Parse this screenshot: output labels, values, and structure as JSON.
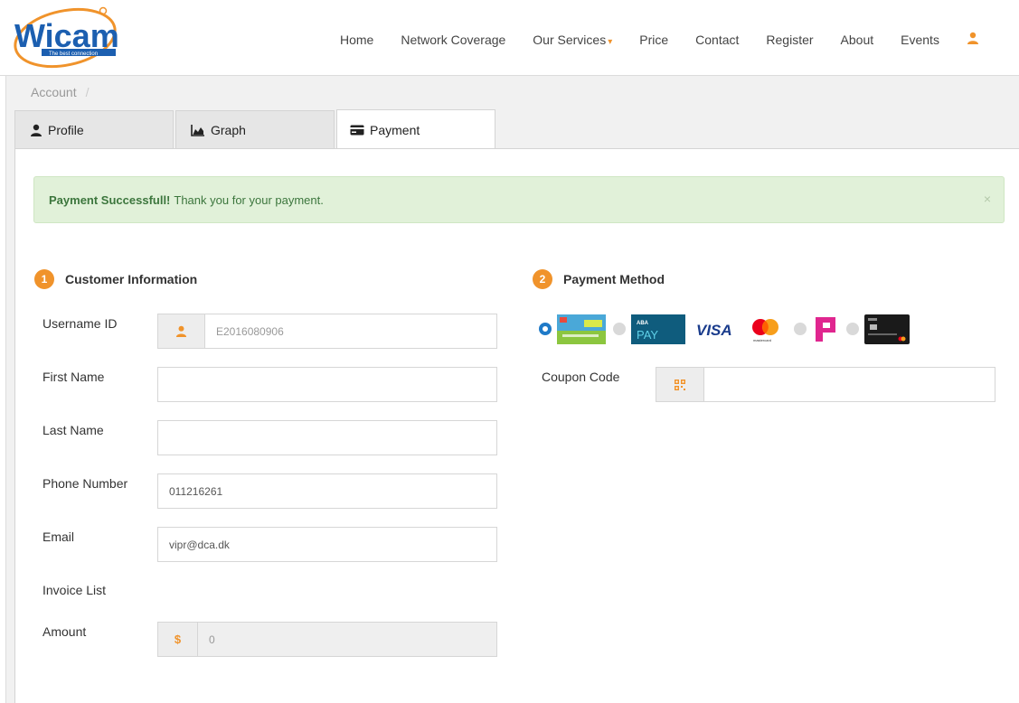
{
  "header": {
    "logo_text": "Wicam",
    "logo_tagline": "The best connection",
    "nav": [
      "Home",
      "Network Coverage",
      "Our Services",
      "Price",
      "Contact",
      "Register",
      "About",
      "Events"
    ],
    "services_caret": "▾"
  },
  "breadcrumb": {
    "item": "Account",
    "sep": "/"
  },
  "tabs": [
    "Profile",
    "Graph",
    "Payment"
  ],
  "alert": {
    "strong": "Payment Successfull!",
    "text": "Thank you for your payment.",
    "close": "×"
  },
  "customer": {
    "step": "1",
    "title": "Customer Information",
    "fields": [
      {
        "label": "Username ID",
        "value": "E2016080906"
      },
      {
        "label": "First Name",
        "value": ""
      },
      {
        "label": "Last Name",
        "value": ""
      },
      {
        "label": "Phone Number",
        "value": "011216261"
      },
      {
        "label": "Email",
        "value": "vipr@dca.dk"
      }
    ],
    "invoice_label": "Invoice List",
    "amount_label": "Amount",
    "amount_symbol": "$",
    "amount_value": "0"
  },
  "payment": {
    "step": "2",
    "title": "Payment Method",
    "methods": [
      "wing-card",
      "aba-pay",
      "visa",
      "mastercard",
      "pipay",
      "black-card"
    ],
    "selected_method": "wing-card",
    "aba_top": "ABA",
    "aba_bottom": "PAY",
    "visa_text": "VISA",
    "mastercard_text": "mastercard",
    "coupon_label": "Coupon Code",
    "coupon_value": ""
  },
  "colors": {
    "accent": "#f0932b",
    "success_bg": "#e1f1d9",
    "success_text": "#3c763d",
    "radio_blue": "#1f7ac8"
  }
}
